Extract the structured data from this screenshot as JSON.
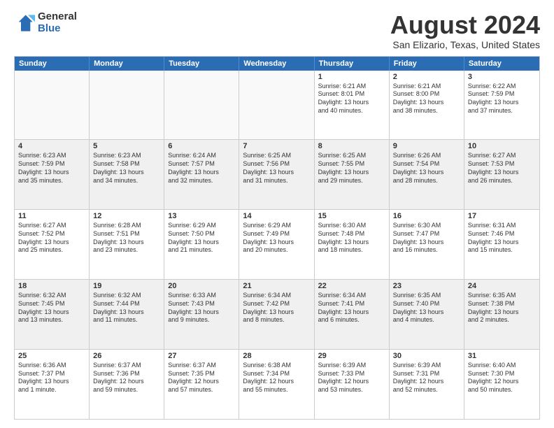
{
  "logo": {
    "general": "General",
    "blue": "Blue"
  },
  "title": "August 2024",
  "subtitle": "San Elizario, Texas, United States",
  "header_days": [
    "Sunday",
    "Monday",
    "Tuesday",
    "Wednesday",
    "Thursday",
    "Friday",
    "Saturday"
  ],
  "rows": [
    [
      {
        "day": "",
        "empty": true,
        "lines": []
      },
      {
        "day": "",
        "empty": true,
        "lines": []
      },
      {
        "day": "",
        "empty": true,
        "lines": []
      },
      {
        "day": "",
        "empty": true,
        "lines": []
      },
      {
        "day": "1",
        "lines": [
          "Sunrise: 6:21 AM",
          "Sunset: 8:01 PM",
          "Daylight: 13 hours",
          "and 40 minutes."
        ]
      },
      {
        "day": "2",
        "lines": [
          "Sunrise: 6:21 AM",
          "Sunset: 8:00 PM",
          "Daylight: 13 hours",
          "and 38 minutes."
        ]
      },
      {
        "day": "3",
        "lines": [
          "Sunrise: 6:22 AM",
          "Sunset: 7:59 PM",
          "Daylight: 13 hours",
          "and 37 minutes."
        ]
      }
    ],
    [
      {
        "day": "4",
        "lines": [
          "Sunrise: 6:23 AM",
          "Sunset: 7:59 PM",
          "Daylight: 13 hours",
          "and 35 minutes."
        ]
      },
      {
        "day": "5",
        "lines": [
          "Sunrise: 6:23 AM",
          "Sunset: 7:58 PM",
          "Daylight: 13 hours",
          "and 34 minutes."
        ]
      },
      {
        "day": "6",
        "lines": [
          "Sunrise: 6:24 AM",
          "Sunset: 7:57 PM",
          "Daylight: 13 hours",
          "and 32 minutes."
        ]
      },
      {
        "day": "7",
        "lines": [
          "Sunrise: 6:25 AM",
          "Sunset: 7:56 PM",
          "Daylight: 13 hours",
          "and 31 minutes."
        ]
      },
      {
        "day": "8",
        "lines": [
          "Sunrise: 6:25 AM",
          "Sunset: 7:55 PM",
          "Daylight: 13 hours",
          "and 29 minutes."
        ]
      },
      {
        "day": "9",
        "lines": [
          "Sunrise: 6:26 AM",
          "Sunset: 7:54 PM",
          "Daylight: 13 hours",
          "and 28 minutes."
        ]
      },
      {
        "day": "10",
        "lines": [
          "Sunrise: 6:27 AM",
          "Sunset: 7:53 PM",
          "Daylight: 13 hours",
          "and 26 minutes."
        ]
      }
    ],
    [
      {
        "day": "11",
        "lines": [
          "Sunrise: 6:27 AM",
          "Sunset: 7:52 PM",
          "Daylight: 13 hours",
          "and 25 minutes."
        ]
      },
      {
        "day": "12",
        "lines": [
          "Sunrise: 6:28 AM",
          "Sunset: 7:51 PM",
          "Daylight: 13 hours",
          "and 23 minutes."
        ]
      },
      {
        "day": "13",
        "lines": [
          "Sunrise: 6:29 AM",
          "Sunset: 7:50 PM",
          "Daylight: 13 hours",
          "and 21 minutes."
        ]
      },
      {
        "day": "14",
        "lines": [
          "Sunrise: 6:29 AM",
          "Sunset: 7:49 PM",
          "Daylight: 13 hours",
          "and 20 minutes."
        ]
      },
      {
        "day": "15",
        "lines": [
          "Sunrise: 6:30 AM",
          "Sunset: 7:48 PM",
          "Daylight: 13 hours",
          "and 18 minutes."
        ]
      },
      {
        "day": "16",
        "lines": [
          "Sunrise: 6:30 AM",
          "Sunset: 7:47 PM",
          "Daylight: 13 hours",
          "and 16 minutes."
        ]
      },
      {
        "day": "17",
        "lines": [
          "Sunrise: 6:31 AM",
          "Sunset: 7:46 PM",
          "Daylight: 13 hours",
          "and 15 minutes."
        ]
      }
    ],
    [
      {
        "day": "18",
        "lines": [
          "Sunrise: 6:32 AM",
          "Sunset: 7:45 PM",
          "Daylight: 13 hours",
          "and 13 minutes."
        ]
      },
      {
        "day": "19",
        "lines": [
          "Sunrise: 6:32 AM",
          "Sunset: 7:44 PM",
          "Daylight: 13 hours",
          "and 11 minutes."
        ]
      },
      {
        "day": "20",
        "lines": [
          "Sunrise: 6:33 AM",
          "Sunset: 7:43 PM",
          "Daylight: 13 hours",
          "and 9 minutes."
        ]
      },
      {
        "day": "21",
        "lines": [
          "Sunrise: 6:34 AM",
          "Sunset: 7:42 PM",
          "Daylight: 13 hours",
          "and 8 minutes."
        ]
      },
      {
        "day": "22",
        "lines": [
          "Sunrise: 6:34 AM",
          "Sunset: 7:41 PM",
          "Daylight: 13 hours",
          "and 6 minutes."
        ]
      },
      {
        "day": "23",
        "lines": [
          "Sunrise: 6:35 AM",
          "Sunset: 7:40 PM",
          "Daylight: 13 hours",
          "and 4 minutes."
        ]
      },
      {
        "day": "24",
        "lines": [
          "Sunrise: 6:35 AM",
          "Sunset: 7:38 PM",
          "Daylight: 13 hours",
          "and 2 minutes."
        ]
      }
    ],
    [
      {
        "day": "25",
        "lines": [
          "Sunrise: 6:36 AM",
          "Sunset: 7:37 PM",
          "Daylight: 13 hours",
          "and 1 minute."
        ]
      },
      {
        "day": "26",
        "lines": [
          "Sunrise: 6:37 AM",
          "Sunset: 7:36 PM",
          "Daylight: 12 hours",
          "and 59 minutes."
        ]
      },
      {
        "day": "27",
        "lines": [
          "Sunrise: 6:37 AM",
          "Sunset: 7:35 PM",
          "Daylight: 12 hours",
          "and 57 minutes."
        ]
      },
      {
        "day": "28",
        "lines": [
          "Sunrise: 6:38 AM",
          "Sunset: 7:34 PM",
          "Daylight: 12 hours",
          "and 55 minutes."
        ]
      },
      {
        "day": "29",
        "lines": [
          "Sunrise: 6:39 AM",
          "Sunset: 7:33 PM",
          "Daylight: 12 hours",
          "and 53 minutes."
        ]
      },
      {
        "day": "30",
        "lines": [
          "Sunrise: 6:39 AM",
          "Sunset: 7:31 PM",
          "Daylight: 12 hours",
          "and 52 minutes."
        ]
      },
      {
        "day": "31",
        "lines": [
          "Sunrise: 6:40 AM",
          "Sunset: 7:30 PM",
          "Daylight: 12 hours",
          "and 50 minutes."
        ]
      }
    ]
  ]
}
